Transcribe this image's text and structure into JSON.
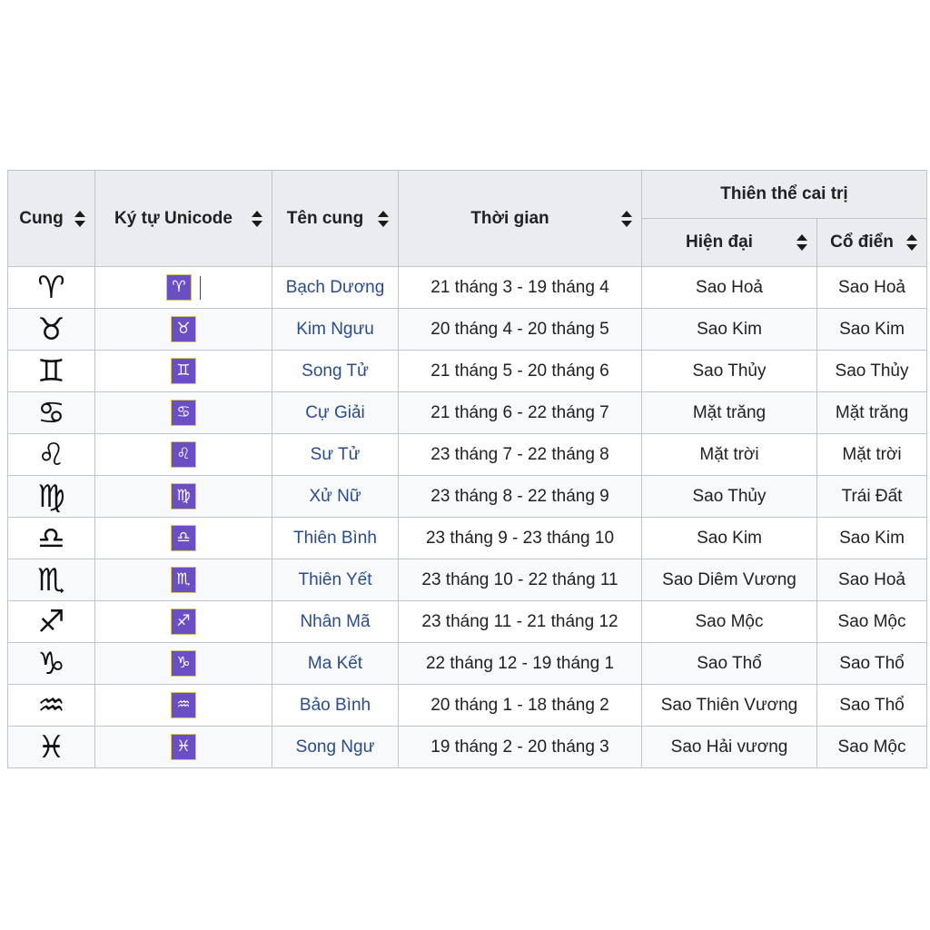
{
  "table": {
    "columns": {
      "sign": {
        "label": "Cung",
        "sortable": true
      },
      "unicode": {
        "label": "Ký tự Unicode",
        "sortable": true
      },
      "name": {
        "label": "Tên cung",
        "sortable": true
      },
      "time": {
        "label": "Thời gian",
        "sortable": true
      },
      "ruler_group": {
        "label": "Thiên thể cai trị",
        "sortable": false
      },
      "modern": {
        "label": "Hiện đại",
        "sortable": true
      },
      "classic": {
        "label": "Cổ điển",
        "sortable": true
      }
    },
    "rows": [
      {
        "glyph": "♈",
        "unicode_char": "♈",
        "name": "Bạch Dương",
        "time": "21 tháng 3 - 19 tháng 4",
        "modern": "Sao Hoả",
        "classic": "Sao Hoả",
        "has_caret": true
      },
      {
        "glyph": "♉",
        "unicode_char": "♉",
        "name": "Kim Ngưu",
        "time": "20 tháng 4 - 20 tháng 5",
        "modern": "Sao Kim",
        "classic": "Sao Kim",
        "has_caret": false
      },
      {
        "glyph": "♊",
        "unicode_char": "♊",
        "name": "Song Tử",
        "time": "21 tháng 5 - 20 tháng 6",
        "modern": "Sao Thủy",
        "classic": "Sao Thủy",
        "has_caret": false
      },
      {
        "glyph": "♋",
        "unicode_char": "♋",
        "name": "Cự Giải",
        "time": "21 tháng 6 - 22 tháng 7",
        "modern": "Mặt trăng",
        "classic": "Mặt trăng",
        "has_caret": false
      },
      {
        "glyph": "♌",
        "unicode_char": "♌",
        "name": "Sư Tử",
        "time": "23 tháng 7 - 22 tháng 8",
        "modern": "Mặt trời",
        "classic": "Mặt trời",
        "has_caret": false
      },
      {
        "glyph": "♍",
        "unicode_char": "♍",
        "name": "Xử Nữ",
        "time": "23 tháng 8 - 22 tháng 9",
        "modern": "Sao Thủy",
        "classic": "Trái Đất",
        "has_caret": false
      },
      {
        "glyph": "♎",
        "unicode_char": "♎",
        "name": "Thiên Bình",
        "time": "23 tháng 9 - 23 tháng 10",
        "modern": "Sao Kim",
        "classic": "Sao Kim",
        "has_caret": false
      },
      {
        "glyph": "♏",
        "unicode_char": "♏",
        "name": "Thiên Yết",
        "time": "23 tháng 10 - 22 tháng 11",
        "modern": "Sao Diêm Vương",
        "classic": "Sao Hoả",
        "has_caret": false
      },
      {
        "glyph": "♐",
        "unicode_char": "♐",
        "name": "Nhân Mã",
        "time": "23 tháng 11 - 21 tháng 12",
        "modern": "Sao Mộc",
        "classic": "Sao Mộc",
        "has_caret": false
      },
      {
        "glyph": "♑",
        "unicode_char": "♑",
        "name": "Ma Kết",
        "time": "22 tháng 12 - 19 tháng 1",
        "modern": "Sao Thổ",
        "classic": "Sao Thổ",
        "has_caret": false
      },
      {
        "glyph": "♒",
        "unicode_char": "♒",
        "name": "Bảo Bình",
        "time": "20 tháng 1 - 18 tháng 2",
        "modern": "Sao Thiên Vương",
        "classic": "Sao Thổ",
        "has_caret": false
      },
      {
        "glyph": "♓",
        "unicode_char": "♓",
        "name": "Song Ngư",
        "time": "19 tháng 2 - 20 tháng 3",
        "modern": "Sao Hải vương",
        "classic": "Sao Mộc",
        "has_caret": false
      }
    ]
  },
  "colors": {
    "header_background": "#eaecf0",
    "border": "#c0c4cc",
    "link": "#2a4b8d",
    "selection_highlight": "#6a4fc4",
    "row_alt": "#f8f9fa",
    "text": "#202122"
  }
}
